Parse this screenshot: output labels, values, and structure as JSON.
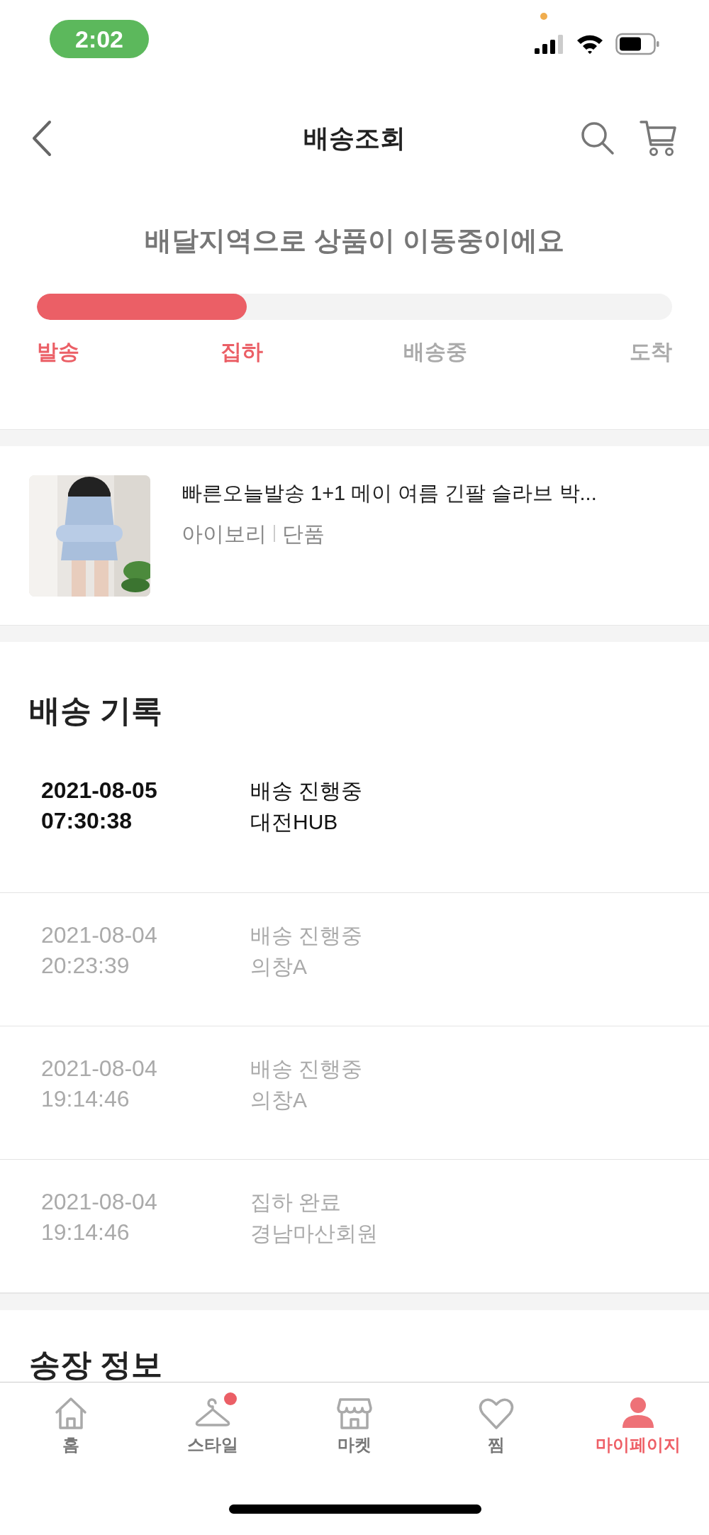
{
  "status_bar": {
    "time": "2:02"
  },
  "header": {
    "title": "배송조회"
  },
  "progress": {
    "message": "배달지역으로 상품이 이동중이에요",
    "level": 0.33,
    "steps": [
      {
        "label": "발송",
        "reached": true
      },
      {
        "label": "집하",
        "reached": true
      },
      {
        "label": "배송중",
        "reached": false
      },
      {
        "label": "도착",
        "reached": false
      }
    ]
  },
  "product": {
    "name": "빠른오늘발송 1+1 메이 여름 긴팔 슬라브 박...",
    "options": [
      "아이보리",
      "단품"
    ]
  },
  "history": {
    "title": "배송 기록",
    "records": [
      {
        "date": "2021-08-05",
        "time": "07:30:38",
        "status": "배송 진행중",
        "location": "대전HUB",
        "current": true
      },
      {
        "date": "2021-08-04",
        "time": "20:23:39",
        "status": "배송 진행중",
        "location": "의창A",
        "current": false
      },
      {
        "date": "2021-08-04",
        "time": "19:14:46",
        "status": "배송 진행중",
        "location": "의창A",
        "current": false
      },
      {
        "date": "2021-08-04",
        "time": "19:14:46",
        "status": "집하 완료",
        "location": "경남마산회원",
        "current": false
      }
    ]
  },
  "invoice": {
    "title": "송장 정보"
  },
  "tab_bar": [
    {
      "kind": "home",
      "label": "홈",
      "selected": false,
      "badge": false
    },
    {
      "kind": "hanger",
      "label": "스타일",
      "selected": false,
      "badge": true
    },
    {
      "kind": "store",
      "label": "마켓",
      "selected": false,
      "badge": false
    },
    {
      "kind": "heart",
      "label": "찜",
      "selected": false,
      "badge": false
    },
    {
      "kind": "person",
      "label": "마이페이지",
      "selected": true,
      "badge": false
    }
  ]
}
